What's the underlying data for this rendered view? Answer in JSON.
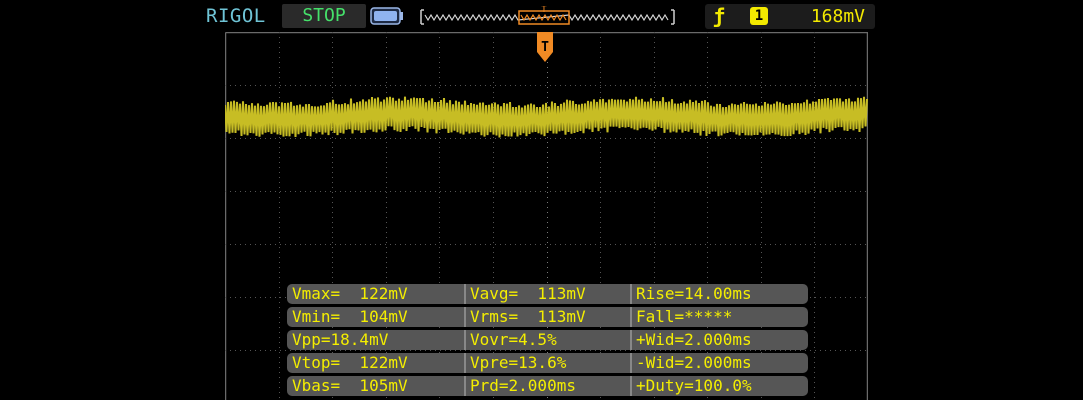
{
  "status_bar": {
    "brand": "RIGOL",
    "run_state": "STOP",
    "trigger": {
      "edge_icon": "rising-edge-icon",
      "source": "1",
      "level": "168mV"
    },
    "trigger_marker": "T"
  },
  "colors": {
    "channel1": "#c7bd24",
    "trigger_marker": "#f08a24",
    "run_state": "#45e06a",
    "brand": "#6fc4d6",
    "measurement_text": "#f4ee00"
  },
  "measurements": [
    [
      "Vmax=  122mV",
      "Vavg=  113mV",
      "Rise=14.00ms"
    ],
    [
      "Vmin=  104mV",
      "Vrms=  113mV",
      "Fall=*****"
    ],
    [
      "Vpp=18.4mV",
      "Vovr=4.5%",
      "+Wid=2.000ms"
    ],
    [
      "Vtop=  122mV",
      "Vpre=13.6%",
      "-Wid=2.000ms"
    ],
    [
      "Vbas=  105mV",
      "Prd=2.000ms",
      "+Duty=100.0%"
    ]
  ]
}
